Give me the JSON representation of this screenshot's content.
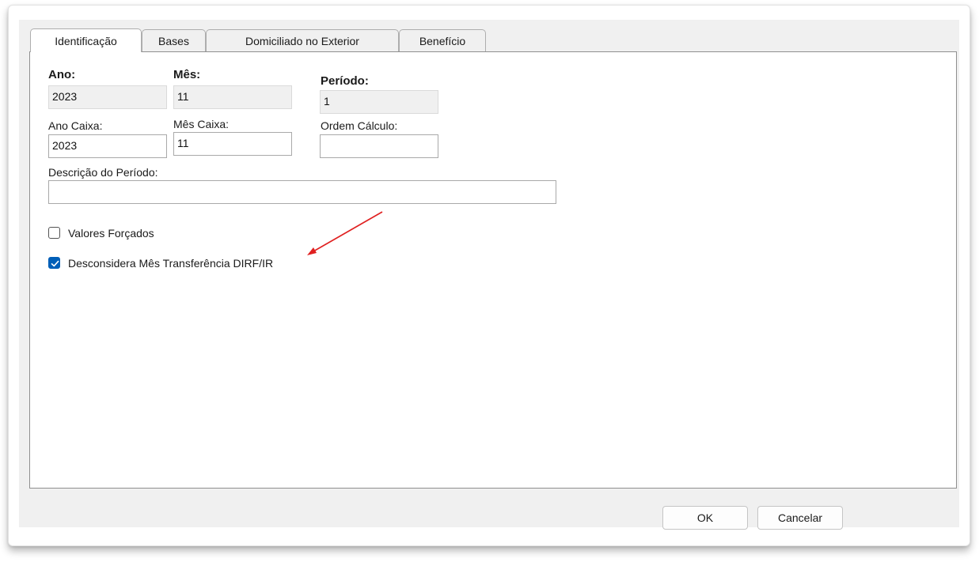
{
  "tabs": [
    {
      "label": "Identificação"
    },
    {
      "label": "Bases"
    },
    {
      "label": "Domiciliado no Exterior"
    },
    {
      "label": "Benefício"
    }
  ],
  "fields": {
    "ano": {
      "label": "Ano:",
      "value": "2023"
    },
    "mes": {
      "label": "Mês:",
      "value": "11"
    },
    "periodo": {
      "label": "Período:",
      "value": "1"
    },
    "ano_caixa": {
      "label": "Ano Caixa:",
      "value": "2023"
    },
    "mes_caixa": {
      "label": "Mês Caixa:",
      "value": "11"
    },
    "ordem_calculo": {
      "label": "Ordem Cálculo:",
      "value": ""
    },
    "descricao": {
      "label": "Descrição do Período:",
      "value": ""
    }
  },
  "checkboxes": {
    "valores_forcados": {
      "label": "Valores Forçados",
      "checked": false
    },
    "desconsidera": {
      "label": "Desconsidera Mês Transferência DIRF/IR",
      "checked": true
    }
  },
  "buttons": {
    "ok": "OK",
    "cancel": "Cancelar"
  },
  "colors": {
    "accent": "#005fb8",
    "annotation_arrow": "#e02020"
  }
}
